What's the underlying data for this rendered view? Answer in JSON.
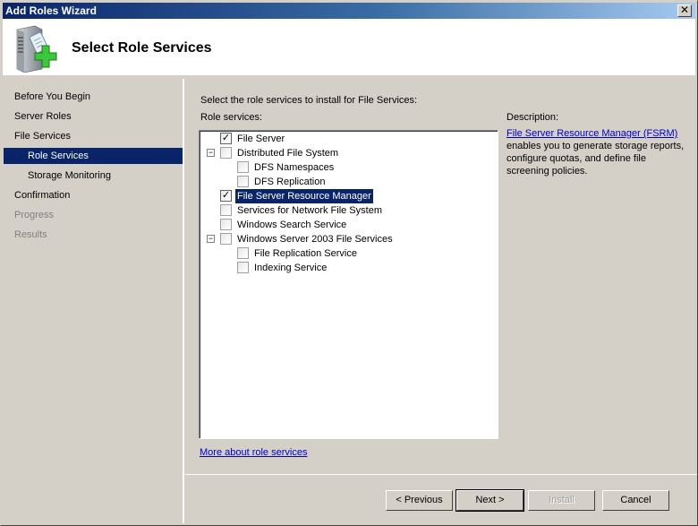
{
  "window": {
    "title": "Add Roles Wizard",
    "close_label": "✕"
  },
  "header": {
    "title": "Select Role Services",
    "icon": "server-role-add-icon"
  },
  "nav": {
    "items": [
      {
        "label": "Before You Begin",
        "state": "normal",
        "level": 0
      },
      {
        "label": "Server Roles",
        "state": "normal",
        "level": 0
      },
      {
        "label": "File Services",
        "state": "normal",
        "level": 0
      },
      {
        "label": "Role Services",
        "state": "selected",
        "level": 1
      },
      {
        "label": "Storage Monitoring",
        "state": "normal",
        "level": 1
      },
      {
        "label": "Confirmation",
        "state": "normal",
        "level": 0
      },
      {
        "label": "Progress",
        "state": "disabled",
        "level": 0
      },
      {
        "label": "Results",
        "state": "disabled",
        "level": 0
      }
    ]
  },
  "main": {
    "intro": "Select the role services to install for File Services:",
    "role_services_label": "Role services:",
    "tree": [
      {
        "label": "File Server",
        "checked": true,
        "level": 0,
        "expander": false,
        "selected": false
      },
      {
        "label": "Distributed File System",
        "checked": false,
        "level": 0,
        "expander": true,
        "selected": false
      },
      {
        "label": "DFS Namespaces",
        "checked": false,
        "level": 1,
        "expander": false,
        "selected": false
      },
      {
        "label": "DFS Replication",
        "checked": false,
        "level": 1,
        "expander": false,
        "selected": false
      },
      {
        "label": "File Server Resource Manager",
        "checked": true,
        "level": 0,
        "expander": false,
        "selected": true
      },
      {
        "label": "Services for Network File System",
        "checked": false,
        "level": 0,
        "expander": false,
        "selected": false
      },
      {
        "label": "Windows Search Service",
        "checked": false,
        "level": 0,
        "expander": false,
        "selected": false
      },
      {
        "label": "Windows Server 2003 File Services",
        "checked": false,
        "level": 0,
        "expander": true,
        "selected": false
      },
      {
        "label": "File Replication Service",
        "checked": false,
        "level": 1,
        "expander": false,
        "selected": false
      },
      {
        "label": "Indexing Service",
        "checked": false,
        "level": 1,
        "expander": false,
        "selected": false
      }
    ],
    "more_link": "More about role services",
    "description": {
      "title": "Description:",
      "link": "File Server Resource Manager (FSRM)",
      "text": " enables you to generate storage reports, configure quotas, and define file screening policies."
    }
  },
  "buttons": {
    "previous": "< Previous",
    "next": "Next >",
    "install": "Install",
    "cancel": "Cancel"
  },
  "colors": {
    "selection": "#0a246a",
    "link": "#0000cc",
    "face": "#d4d0c8"
  }
}
